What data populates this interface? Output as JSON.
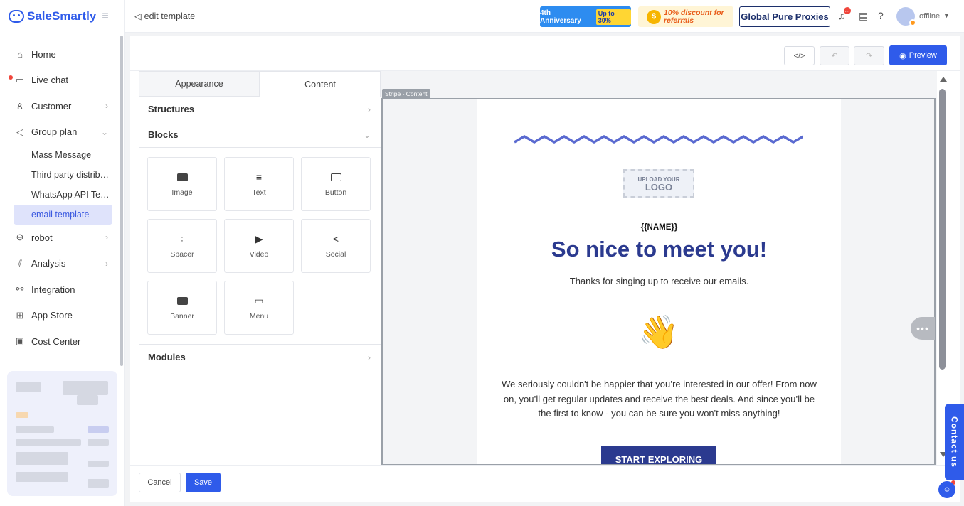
{
  "brand": {
    "name": "SaleSmartly",
    "accent": "#2f5bea"
  },
  "sidebar": {
    "items": [
      {
        "label": "Home",
        "icon": "home-icon"
      },
      {
        "label": "Live chat",
        "icon": "chat-icon"
      },
      {
        "label": "Customer",
        "icon": "users-icon"
      },
      {
        "label": "Group plan",
        "icon": "send-icon"
      },
      {
        "label": "robot",
        "icon": "robot-icon"
      },
      {
        "label": "Analysis",
        "icon": "chart-icon"
      },
      {
        "label": "Integration",
        "icon": "integration-icon"
      },
      {
        "label": "App Store",
        "icon": "grid-icon"
      },
      {
        "label": "Cost Center",
        "icon": "wallet-icon"
      }
    ],
    "group_plan_sub": [
      "Mass Message",
      "Third party distrib…",
      "WhatsApp API Te…",
      "email template"
    ]
  },
  "topbar": {
    "breadcrumb": "edit template",
    "promo1": {
      "text": "4th Anniversary",
      "tag": "Up to 30%"
    },
    "promo2": {
      "text": "10% discount for referrals"
    },
    "promo3": {
      "text": "Global Pure Proxies"
    },
    "status": "offline"
  },
  "toolbar": {
    "code_label": "</>",
    "undo_label": "↶",
    "redo_label": "↷",
    "preview_label": "Preview"
  },
  "panel": {
    "tabs": [
      "Appearance",
      "Content"
    ],
    "sections": {
      "structures": "Structures",
      "blocks": "Blocks",
      "modules": "Modules"
    },
    "blocks": [
      "Image",
      "Text",
      "Button",
      "Spacer",
      "Video",
      "Social",
      "Banner",
      "Menu"
    ]
  },
  "canvas": {
    "stripe_label": "Stripe - Content",
    "logo_small": "UPLOAD YOUR",
    "logo_big": "LOGO",
    "name_tag": "{{NAME}}",
    "title": "So nice to meet you!",
    "subtitle": "Thanks for singing up to receive our emails.",
    "wave_emoji": "👋",
    "body": "We seriously couldn't be happier that you’re interested in our offer! From now on, you’ll get regular updates and receive the best deals. And since you’ll be the first to know - you can be sure you won't miss anything!",
    "cta": "START EXPLORING",
    "title_color": "#2b3a8f"
  },
  "footer": {
    "cancel_label": "Cancel",
    "save_label": "Save"
  },
  "contact": {
    "label": "Contact us"
  }
}
